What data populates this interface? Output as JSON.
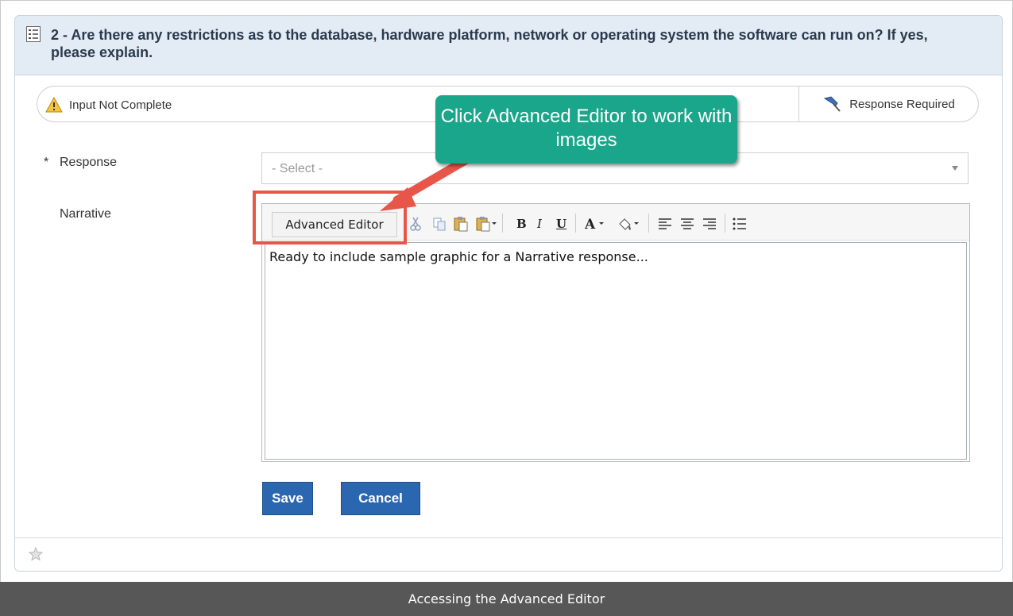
{
  "question": {
    "title": "2 - Are there any restrictions as to the database, hardware platform, network or operating system the software can run on? If yes, please explain.",
    "icon": "checklist-icon"
  },
  "status": {
    "left_text": "Input Not Complete",
    "left_icon": "warning-icon",
    "right_text": "Response Required",
    "right_icon": "pin-icon"
  },
  "form": {
    "response_required_marker": "*",
    "response_label": "Response",
    "response_placeholder": "- Select -",
    "narrative_label": "Narrative"
  },
  "editor": {
    "advanced_button": "Advanced Editor",
    "toolbar_icons": [
      "cut-icon",
      "copy-icon",
      "paste-icon",
      "paste-special-icon",
      "bold-icon",
      "italic-icon",
      "underline-icon",
      "font-color-icon",
      "highlight-color-icon",
      "align-left-icon",
      "align-center-icon",
      "align-right-icon",
      "bullet-list-icon"
    ],
    "content": "Ready to include sample graphic for a Narrative response..."
  },
  "actions": {
    "save": "Save",
    "cancel": "Cancel"
  },
  "callout": {
    "text": "Click Advanced Editor to work with images",
    "color": "#19a68a"
  },
  "highlight_color": "#e8564a",
  "caption": "Accessing the Advanced Editor"
}
